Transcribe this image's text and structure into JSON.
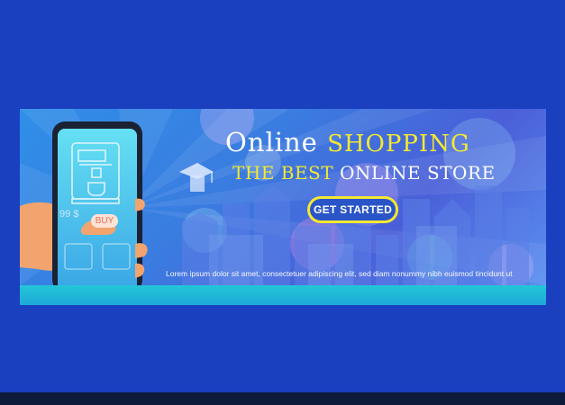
{
  "banner": {
    "title_word1": "Online",
    "title_word2": "SHOPPING",
    "subtitle_word1": "THE BEST",
    "subtitle_word2": "ONLINE STORE",
    "cta_label": "GET STARTED",
    "caption": "Lorem ipsum dolor sit amet, consectetuer adipiscing elit, sed diam nonummy nibh euismod tincidunt ut"
  },
  "phone": {
    "price": "99 $",
    "buy_label": "BUY"
  },
  "colors": {
    "page_background": "#1a3fbf",
    "accent_yellow": "#f3e832",
    "bottom_glow": "#22c7d6"
  },
  "icons": [
    "graduation-cap-icon",
    "coffee-machine-icon"
  ]
}
